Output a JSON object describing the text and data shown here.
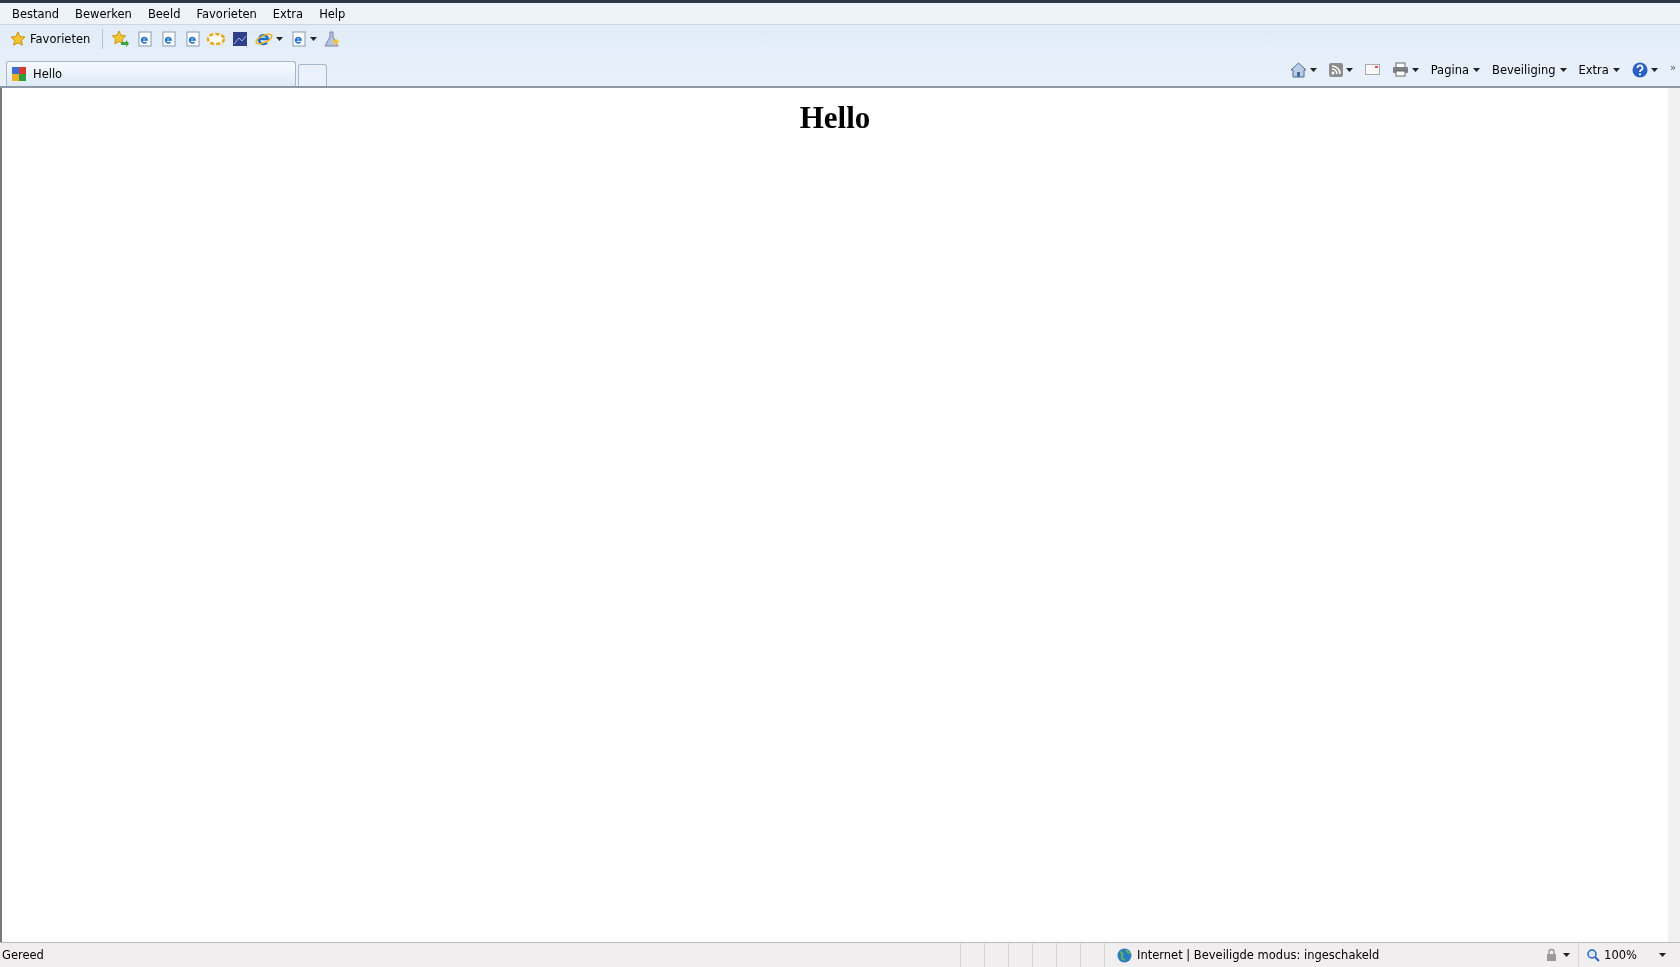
{
  "menu": [
    "Bestand",
    "Bewerken",
    "Beeld",
    "Favorieten",
    "Extra",
    "Help"
  ],
  "favorites_button": "Favorieten",
  "tabs": [
    {
      "label": "Hello",
      "selected": true
    }
  ],
  "command_bar": {
    "menus": [
      "Pagina",
      "Beveiliging",
      "Extra"
    ],
    "overflow": "»"
  },
  "page": {
    "heading": "Hello"
  },
  "status_bar": {
    "text": "Gereed",
    "zone": "Internet | Beveiligde modus: ingeschakeld",
    "zoom": "100%"
  }
}
